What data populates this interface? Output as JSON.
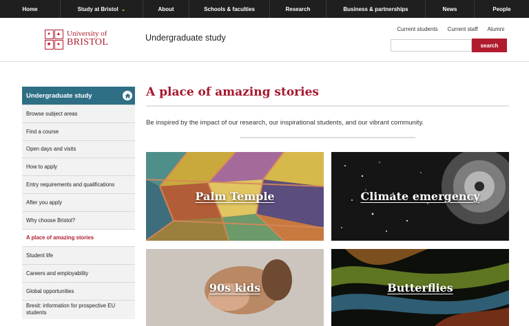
{
  "topnav": {
    "items": [
      "Home",
      "Study at Bristol",
      "About",
      "Schools & faculties",
      "Research",
      "Business & partnerships",
      "News",
      "People"
    ]
  },
  "header": {
    "logo_line1": "University of",
    "logo_line2": "BRISTOL",
    "site_title": "Undergraduate study",
    "util_links": [
      "Current students",
      "Current staff",
      "Alumni"
    ],
    "search_placeholder": "",
    "search_button": "search"
  },
  "sidebar": {
    "heading": "Undergraduate study",
    "items": [
      "Browse subject areas",
      "Find a course",
      "Open days and visits",
      "How to apply",
      "Entry requirements and qualifications",
      "After you apply",
      "Why choose Bristol?",
      "A place of amazing stories",
      "Student life",
      "Careers and employability",
      "Global opportunities",
      "Brexit: information for prospective EU students"
    ],
    "active": "A place of amazing stories"
  },
  "main": {
    "title": "A place of amazing stories",
    "intro": "Be inspired by the impact of our research, our inspirational students, and our vibrant community.",
    "tiles": [
      {
        "label": "Palm Temple"
      },
      {
        "label": "Climate emergency"
      },
      {
        "label": "90s kids"
      },
      {
        "label": "Butterflies"
      }
    ]
  },
  "colors": {
    "brand_red": "#b01c2e",
    "sidebar_teal": "#2e6f86",
    "topnav_bg": "#1f1f1f"
  }
}
